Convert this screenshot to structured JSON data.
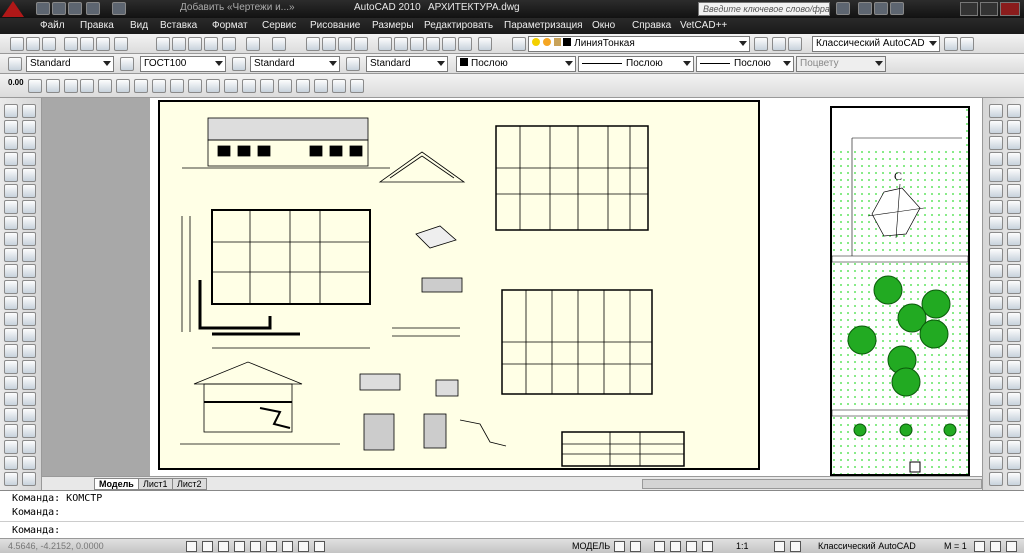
{
  "title": {
    "app": "AutoCAD 2010",
    "document": "АРХИТЕКТУРА.dwg",
    "search_placeholder": "Введите ключевое слово/фразу",
    "breadcrumb": "Добавить «Чертежи и...»"
  },
  "menu": [
    "Файл",
    "Правка",
    "Вид",
    "Вставка",
    "Формат",
    "Сервис",
    "Рисование",
    "Размеры",
    "Редактировать",
    "Параметризация",
    "Окно",
    "Справка",
    "VetCAD++"
  ],
  "toolbar1": {
    "layer_value": "ЛинияТонкая",
    "workspace_value": "Классический AutoCAD"
  },
  "toolbar2": {
    "text_style": "Standard",
    "dim_style": "ГОСТ100",
    "table_style": "Standard",
    "mleader_style": "Standard",
    "color": "Послою",
    "linetype": "Послою",
    "lineweight": "Послою",
    "plotstyle": "Поцвету"
  },
  "toolbar3": {
    "dim_text": "0.00"
  },
  "tabs": [
    "Модель",
    "Лист1",
    "Лист2"
  ],
  "command": {
    "line1": "Команда: КОМСТР",
    "line2": "Команда:",
    "prompt": "Команда:"
  },
  "status": {
    "coords": "4.5646, -4.2152, 0.0000",
    "model": "МОДЕЛЬ",
    "scale": "1:1",
    "workspace": "Классический AutoCAD",
    "model_scale": "M = 1"
  },
  "drawing": {
    "north_label": "С"
  },
  "colors": {
    "titlebar": "#1a1a1a",
    "paper": "#ffffe6",
    "tree_green": "#22aa22",
    "grass_dot": "#33dd33"
  }
}
